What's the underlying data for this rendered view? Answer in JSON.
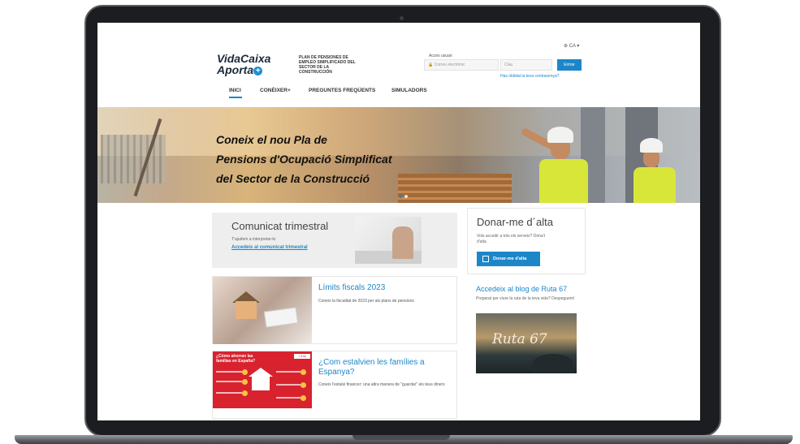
{
  "header": {
    "logo_line1": "VidaCaixa",
    "logo_line2": "Aporta",
    "logo_plus": "+",
    "tagline": "PLAN DE PENSIONES DE EMPLEO SIMPLIFICADO DEL SECTOR DE LA CONSTRUCCIÓN",
    "language": "⊕ CA ▾",
    "access_label": "Accés usuari",
    "user_placeholder": "🔒 Correu electrònic",
    "password_placeholder": "Clau",
    "enter_label": "Entrar",
    "forgot_link": "Has oblidat la teva contrasenya?"
  },
  "nav": {
    "items": [
      "INICI",
      "CONÈIXER+",
      "PREGUNTES FREQÜENTS",
      "SIMULADORS"
    ],
    "active": "INICI"
  },
  "hero": {
    "line1": "Coneix el nou Pla de",
    "line2": "Pensions d'Ocupació Simplificat",
    "line3": "del Sector de la Construcció"
  },
  "comunicat": {
    "title": "Comunicat trimestral",
    "subtitle": "T'ajudem a interpretar-lo",
    "link": "Accedeix al comunicat trimestral"
  },
  "donar": {
    "title": "Donar-me d´alta",
    "subtitle": "Vols accedir a tots els serveis? Dóna't d'alta",
    "button": "Donar-me d'alta"
  },
  "limits": {
    "title": "Límits fiscals 2023",
    "text": "Coneix la fiscalitat de 2023 per als plans de pensions"
  },
  "estalvien": {
    "title": "¿Com estalvien les famílies a Espanya?",
    "text": "Coneix l'estalvi financer: una altra manera de \"guardar\" els teus diners",
    "infographic_title": "¿Cómo ahorran las familias en España?",
    "infographic_badge": "+ info"
  },
  "blog": {
    "title": "Accedeix al blog de Ruta 67",
    "subtitle": "Preparat per viure la ruta de la teva vida? Despeguem!",
    "logo_text": "Ruta 67"
  },
  "colors": {
    "accent": "#1c86c8",
    "infographic_red": "#d8232f",
    "vest": "#d8e63a"
  }
}
